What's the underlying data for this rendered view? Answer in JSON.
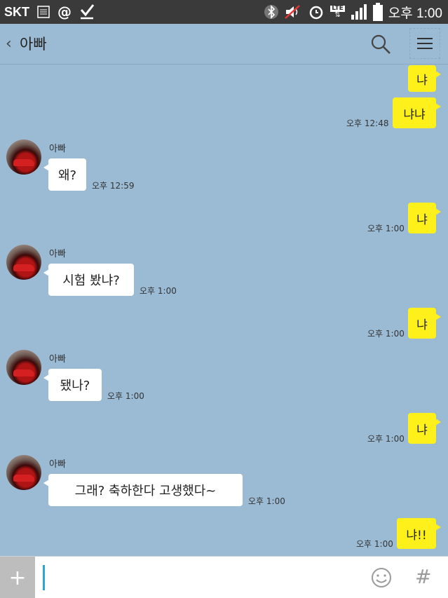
{
  "status_bar": {
    "carrier": "SKT",
    "at_symbol": "@",
    "network": "LTE",
    "time": "오후 1:00"
  },
  "header": {
    "back": "‹",
    "title": "아빠"
  },
  "messages": [
    {
      "from": "me",
      "text": "냐",
      "time": ""
    },
    {
      "from": "me",
      "text": "냐냐",
      "time": "오후 12:48"
    },
    {
      "from": "other",
      "sender": "아빠",
      "text": "왜?",
      "time": "오후 12:59"
    },
    {
      "from": "me",
      "text": "냐",
      "time": "오후 1:00"
    },
    {
      "from": "other",
      "sender": "아빠",
      "text": "시험 봤냐?",
      "time": "오후 1:00"
    },
    {
      "from": "me",
      "text": "냐",
      "time": "오후 1:00"
    },
    {
      "from": "other",
      "sender": "아빠",
      "text": "됐나?",
      "time": "오후 1:00"
    },
    {
      "from": "me",
      "text": "냐",
      "time": "오후 1:00"
    },
    {
      "from": "other",
      "sender": "아빠",
      "text": "그래? 축하한다 고생했다~",
      "time": "오후 1:00"
    },
    {
      "from": "me",
      "text": "냐!!",
      "time": "오후 1:00"
    }
  ],
  "input_bar": {
    "plus": "+",
    "hash": "#"
  }
}
